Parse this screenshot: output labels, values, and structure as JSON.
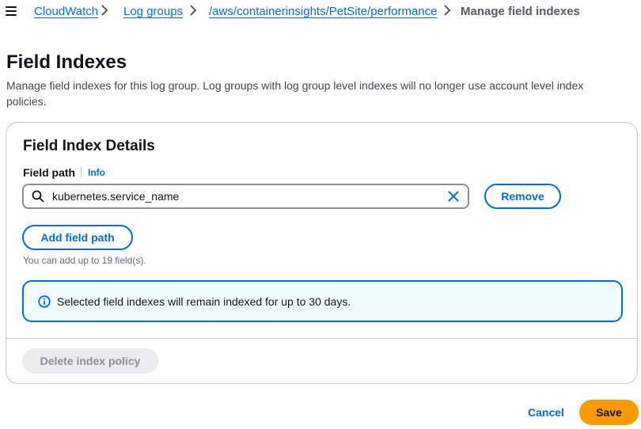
{
  "breadcrumb": {
    "items": [
      {
        "label": "CloudWatch"
      },
      {
        "label": "Log groups"
      },
      {
        "label": "/aws/containerinsights/PetSite/performance"
      },
      {
        "label": "Manage field indexes"
      }
    ]
  },
  "page": {
    "title": "Field Indexes",
    "description": "Manage field indexes for this log group. Log groups with log group level indexes will no longer use account level index policies."
  },
  "details": {
    "title": "Field Index Details",
    "field_label": "Field path",
    "info_label": "Info",
    "field_value": "kubernetes.service_name",
    "remove_label": "Remove",
    "add_label": "Add field path",
    "hint": "You can add up to 19 field(s).",
    "alert_text": "Selected field indexes will remain indexed for up to 30 days.",
    "delete_label": "Delete index policy"
  },
  "footer": {
    "cancel_label": "Cancel",
    "save_label": "Save"
  },
  "colors": {
    "link": "#006ce0",
    "primary": "#ff9900",
    "alert_bg": "#f0fbff",
    "disabled_bg": "#ebebf0"
  }
}
